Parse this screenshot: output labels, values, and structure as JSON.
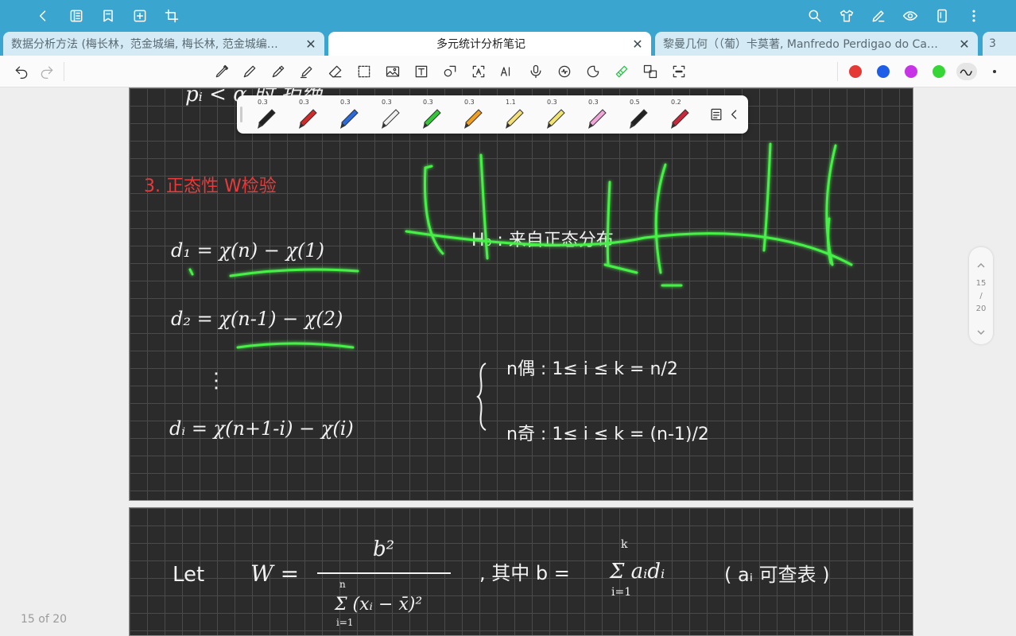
{
  "tabs": [
    {
      "title": "数据分析方法 (梅长林，范金城编, 梅长林, 范金城编…",
      "active": false
    },
    {
      "title": "多元统计分析笔记",
      "active": true
    },
    {
      "title": "黎曼几何（（葡）卡莫著, Manfredo Perdigao do Ca…",
      "active": false
    }
  ],
  "tab_more": "3",
  "tab_close_glyph": "✕",
  "colors": {
    "topbar": "#3aa5cf",
    "pen_colors": [
      "#e53935",
      "#1e5de8",
      "#c634e6",
      "#37d637"
    ],
    "ink_green": "#46f046",
    "ink_red": "#e83a3a",
    "ink_white": "#f2f2f2"
  },
  "pen_tray": [
    {
      "size": "0.3",
      "color": "#222222"
    },
    {
      "size": "0.3",
      "color": "#d22a2a"
    },
    {
      "size": "0.3",
      "color": "#2b6ad8"
    },
    {
      "size": "0.3",
      "color": "#f0f0f0"
    },
    {
      "size": "0.3",
      "color": "#35c63a"
    },
    {
      "size": "0.3",
      "color": "#f0a020"
    },
    {
      "size": "1.1",
      "color": "#f4e07a"
    },
    {
      "size": "0.3",
      "color": "#f2e472"
    },
    {
      "size": "0.3",
      "color": "#f0a6d8"
    },
    {
      "size": "0.5",
      "color": "#222222"
    },
    {
      "size": "0.2",
      "color": "#c8283a"
    }
  ],
  "scroller": {
    "current": "15",
    "sep": "/",
    "total": "20"
  },
  "page_counter": "15 of 20",
  "notes_page1": {
    "heading": "3. 正态性 W检验",
    "d1": "d₁ =  χ(n) − χ(1)",
    "d2": "d₂ =  χ(n-1) − χ(2)",
    "vdots": "⋮",
    "di": "dᵢ =  χ(n+1-i) − χ(i)",
    "h0": "H₀ : 来自正态分布",
    "even": "n偶 :   1≤ i ≤  k = n/2",
    "odd": "n奇 :   1≤ i ≤  k = (n-1)/2",
    "top_cut": "pᵢ < α  时  拒绝"
  },
  "notes_page2": {
    "let": "Let",
    "w": "W =",
    "num": "b²",
    "den": "Σ (xᵢ − x̄)²",
    "den_lower": "i=1",
    "den_upper": "n",
    "where": ", 其中  b =",
    "sum_expr": "Σ aᵢdᵢ",
    "sum_lower": "i=1",
    "sum_upper": "k",
    "note": "( aᵢ 可查表 )"
  }
}
